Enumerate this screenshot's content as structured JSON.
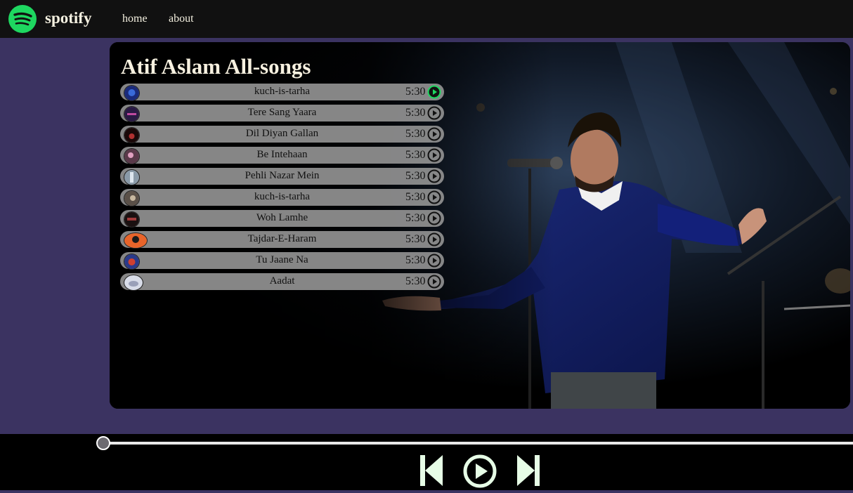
{
  "nav": {
    "brand": "spotify",
    "links": [
      {
        "label": "home"
      },
      {
        "label": "about"
      }
    ]
  },
  "main": {
    "title": "Atif Aslam All-songs",
    "songs": [
      {
        "name": "kuch-is-tarha",
        "duration": "5:30",
        "active": true
      },
      {
        "name": "Tere Sang Yaara",
        "duration": "5:30",
        "active": false
      },
      {
        "name": "Dil Diyan Gallan",
        "duration": "5:30",
        "active": false
      },
      {
        "name": "Be Intehaan",
        "duration": "5:30",
        "active": false
      },
      {
        "name": "Pehli Nazar Mein",
        "duration": "5:30",
        "active": false
      },
      {
        "name": "kuch-is-tarha",
        "duration": "5:30",
        "active": false
      },
      {
        "name": "Woh Lamhe",
        "duration": "5:30",
        "active": false
      },
      {
        "name": "Tajdar-E-Haram",
        "duration": "5:30",
        "active": false
      },
      {
        "name": "Tu Jaane Na",
        "duration": "5:30",
        "active": false
      },
      {
        "name": "Aadat",
        "duration": "5:30",
        "active": false
      }
    ]
  },
  "player": {
    "progress": 0,
    "icons": [
      "skip-back-icon",
      "play-icon",
      "skip-forward-icon"
    ]
  },
  "colors": {
    "page_bg": "#3b3361",
    "nav_bg": "#111111",
    "brand_green": "#1ed760",
    "control_color": "#e6fde6",
    "row_bg": "#919191"
  }
}
